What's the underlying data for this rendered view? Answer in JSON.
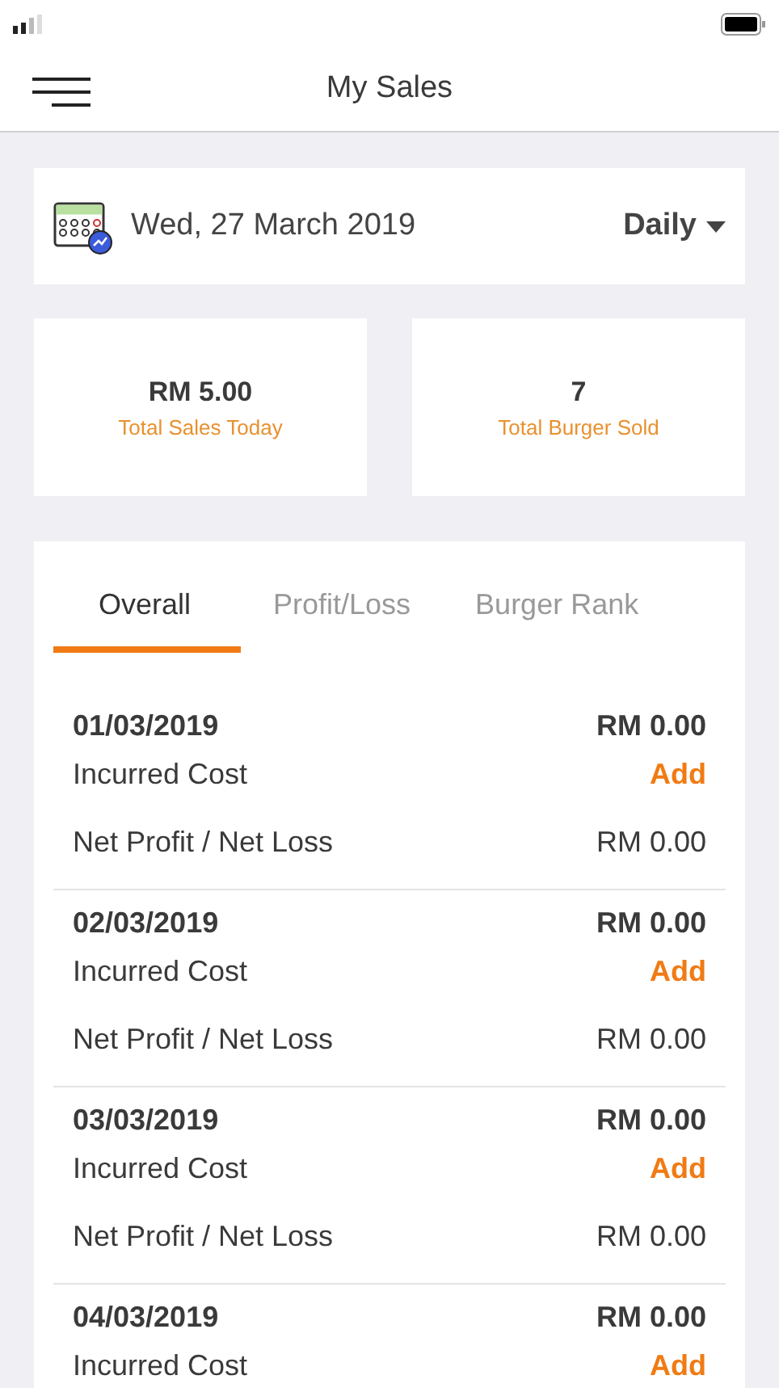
{
  "header": {
    "title": "My Sales"
  },
  "date_card": {
    "date": "Wed, 27 March 2019",
    "period": "Daily"
  },
  "stats": [
    {
      "value": "RM 5.00",
      "label": "Total Sales Today"
    },
    {
      "value": "7",
      "label": "Total Burger Sold"
    }
  ],
  "tabs": [
    {
      "label": "Overall",
      "selected": true
    },
    {
      "label": "Profit/Loss",
      "selected": false
    },
    {
      "label": "Burger Rank",
      "selected": false
    }
  ],
  "entries": [
    {
      "date": "01/03/2019",
      "total": "RM 0.00",
      "cost_label": "Incurred Cost",
      "cost_action": "Add",
      "net_label": "Net Profit / Net Loss",
      "net_value": "RM 0.00"
    },
    {
      "date": "02/03/2019",
      "total": "RM 0.00",
      "cost_label": "Incurred Cost",
      "cost_action": "Add",
      "net_label": "Net Profit / Net Loss",
      "net_value": "RM 0.00"
    },
    {
      "date": "03/03/2019",
      "total": "RM 0.00",
      "cost_label": "Incurred Cost",
      "cost_action": "Add",
      "net_label": "Net Profit / Net Loss",
      "net_value": "RM 0.00"
    },
    {
      "date": "04/03/2019",
      "total": "RM 0.00",
      "cost_label": "Incurred Cost",
      "cost_action": "Add"
    }
  ]
}
